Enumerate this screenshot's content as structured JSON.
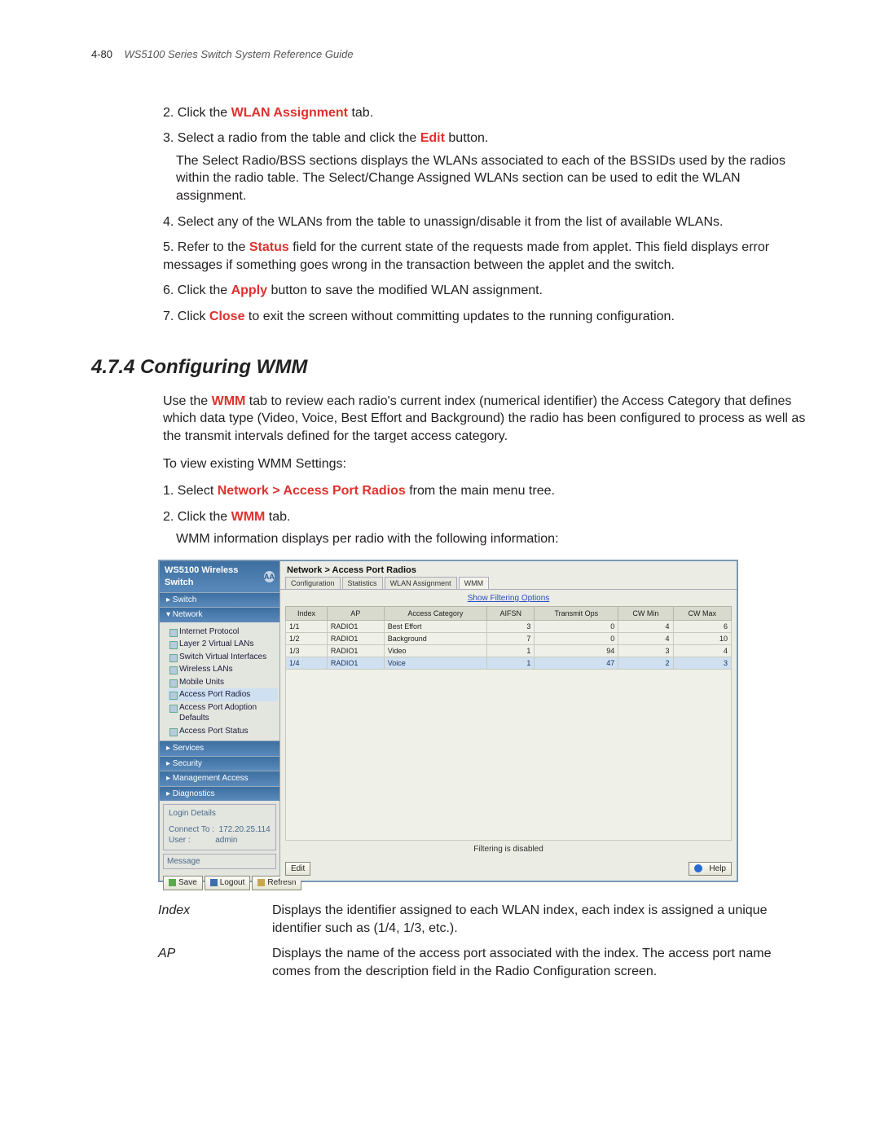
{
  "page_header": {
    "num": "4-80",
    "title": "WS5100 Series Switch System Reference Guide"
  },
  "top_steps": {
    "s2_a": "2. Click the ",
    "s2_b": "WLAN Assignment",
    "s2_c": " tab.",
    "s3_a": "3. Select a radio from the table and click the ",
    "s3_b": "Edit",
    "s3_c": " button.",
    "s3_sub": "The Select Radio/BSS sections displays the WLANs associated to each of the BSSIDs used by the radios within the radio table. The Select/Change Assigned WLANs section can be used to edit the WLAN assignment.",
    "s4": "4. Select any of the WLANs from the table to unassign/disable it from the list of available WLANs.",
    "s5_a": "5. Refer to the ",
    "s5_b": "Status",
    "s5_c": " field for the current state of the requests made from applet. This field displays error messages if something goes wrong in the transaction between the applet and the switch.",
    "s6_a": "6. Click the ",
    "s6_b": "Apply",
    "s6_c": " button to save the modified WLAN assignment.",
    "s7_a": "7. Click ",
    "s7_b": "Close",
    "s7_c": " to exit the screen without committing updates to the running configuration."
  },
  "section": {
    "heading": "4.7.4 Configuring WMM",
    "p1_a": "Use the ",
    "p1_b": "WMM",
    "p1_c": " tab to review each radio's current index (numerical identifier) the Access Category that defines which data type (Video, Voice, Best Effort and Background) the radio has been configured to process as well as the transmit intervals defined for the target access category.",
    "p2": "To view existing WMM Settings:",
    "s1_a": "1. Select ",
    "s1_b": "Network > Access Port Radios",
    "s1_c": " from the main menu tree.",
    "s2_a": "2. Click the ",
    "s2_b": "WMM",
    "s2_c": " tab.",
    "s2_sub": "WMM information displays per radio with the following information:"
  },
  "ui": {
    "brand": "WS5100 Wireless Switch",
    "brand_badge": "AA",
    "crumb": "Network > Access Port Radios",
    "tabs": [
      "Configuration",
      "Statistics",
      "WLAN Assignment",
      "WMM"
    ],
    "nav": {
      "switch": "▸ Switch",
      "network": "▾ Network",
      "services": "▸ Services",
      "security": "▸ Security",
      "mgmt": "▸ Management Access",
      "diag": "▸ Diagnostics"
    },
    "tree": [
      "Internet Protocol",
      "Layer 2 Virtual LANs",
      "Switch Virtual Interfaces",
      "Wireless LANs",
      "Mobile Units",
      "Access Port Radios",
      "Access Port Adoption Defaults",
      "Access Port Status"
    ],
    "login": {
      "legend": "Login Details",
      "connect_lbl": "Connect To :",
      "connect_v": "172.20.25.114",
      "user_lbl": "User :",
      "user_v": "admin"
    },
    "msg_legend": "Message",
    "side_btns": {
      "save": "Save",
      "logout": "Logout",
      "refresh": "Refresh"
    },
    "filter_link": "Show Filtering Options",
    "filter_note": "Filtering is disabled",
    "main_btns": {
      "edit": "Edit",
      "help": "Help"
    },
    "table": {
      "headers": [
        "Index",
        "AP",
        "Access Category",
        "AIFSN",
        "Transmit Ops",
        "CW Min",
        "CW Max"
      ],
      "rows": [
        {
          "cells": [
            "1/1",
            "RADIO1",
            "Best Effort",
            "3",
            "0",
            "4",
            "6"
          ],
          "hl": false
        },
        {
          "cells": [
            "1/2",
            "RADIO1",
            "Background",
            "7",
            "0",
            "4",
            "10"
          ],
          "hl": false
        },
        {
          "cells": [
            "1/3",
            "RADIO1",
            "Video",
            "1",
            "94",
            "3",
            "4"
          ],
          "hl": false
        },
        {
          "cells": [
            "1/4",
            "RADIO1",
            "Voice",
            "1",
            "47",
            "2",
            "3"
          ],
          "hl": true
        }
      ]
    }
  },
  "desc": {
    "r1_t": "Index",
    "r1_d": "Displays the identifier assigned to each WLAN index, each index is assigned a unique identifier such as (1/4, 1/3, etc.).",
    "r2_t": "AP",
    "r2_d": "Displays the name of the access port associated with the index. The access port name comes from the description field in the Radio Configuration screen."
  }
}
